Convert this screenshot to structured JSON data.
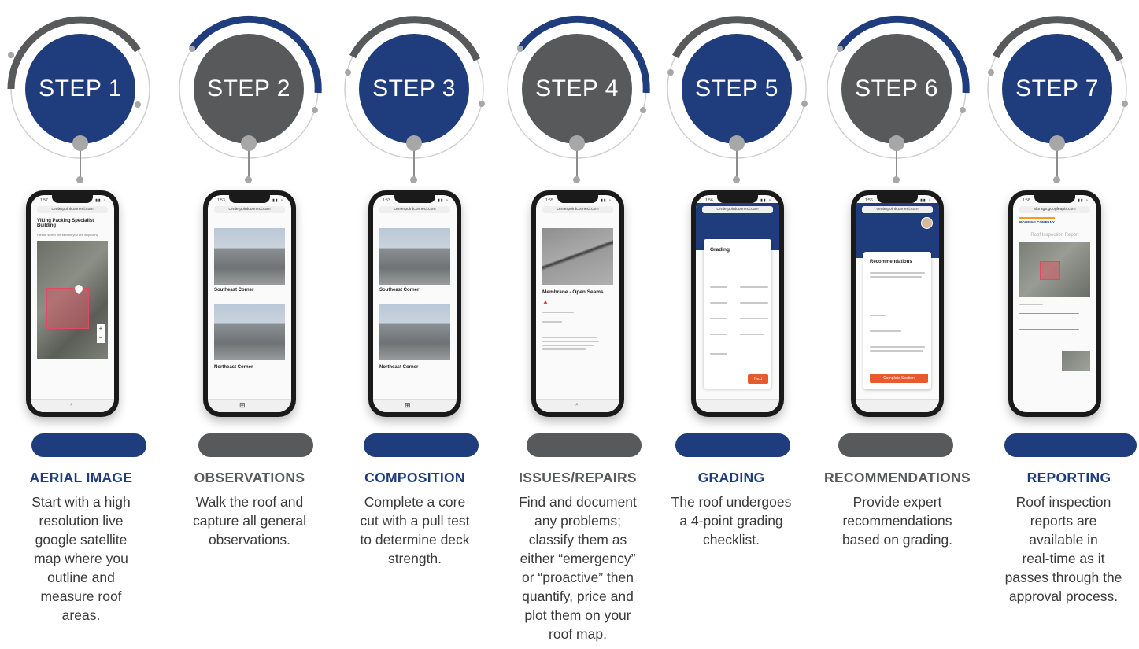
{
  "colors": {
    "navy": "#1f3c7c",
    "charcoal": "#58595b",
    "arc_gray": "#5c5c5c",
    "ring_gray": "#d0d0d0"
  },
  "steps": [
    {
      "badge": "STEP 1",
      "badge_color": "navy",
      "arc_color": "charcoal",
      "title": "AERIAL IMAGE",
      "title_color": "navy",
      "desc": [
        "Start with a high",
        "resolution live",
        "google satellite",
        "map where you",
        "outline and",
        "measure roof",
        "areas."
      ],
      "screen": {
        "url": "centerpointconnect.com",
        "heading": "Viking Packing Specialist Building",
        "subtext": "Please select the section you are inspecting"
      }
    },
    {
      "badge": "STEP 2",
      "badge_color": "charcoal",
      "arc_color": "navy",
      "title": "OBSERVATIONS",
      "title_color": "charcoal",
      "desc": [
        "Walk the roof and",
        "capture all general",
        "observations."
      ],
      "screen": {
        "url": "centerpointconnect.com",
        "caption_1": "Southeast Corner",
        "caption_2": "Northeast Corner"
      }
    },
    {
      "badge": "STEP 3",
      "badge_color": "navy",
      "arc_color": "charcoal",
      "title": "COMPOSITION",
      "title_color": "navy",
      "desc": [
        "Complete a core",
        "cut with a pull test",
        "to determine deck",
        "strength."
      ],
      "screen": {
        "url": "centerpointconnect.com",
        "caption_1": "Southeast Corner",
        "caption_2": "Northeast Corner"
      }
    },
    {
      "badge": "STEP 4",
      "badge_color": "charcoal",
      "arc_color": "navy",
      "title": "ISSUES/REPAIRS",
      "title_color": "charcoal",
      "desc": [
        "Find and document",
        "any problems;",
        "classify them as",
        "either “emergency”",
        "or “proactive” then",
        "quantify, price and",
        "plot them on your",
        "roof map."
      ],
      "screen": {
        "url": "centerpointconnect.com",
        "heading": "Membrane - Open Seams"
      }
    },
    {
      "badge": "STEP 5",
      "badge_color": "navy",
      "arc_color": "charcoal",
      "title": "GRADING",
      "title_color": "navy",
      "desc": [
        "The roof undergoes",
        "a 4-point grading",
        "checklist."
      ],
      "screen": {
        "url": "centerpointconnect.com",
        "heading": "Grading",
        "button": "Next"
      }
    },
    {
      "badge": "STEP 6",
      "badge_color": "charcoal",
      "arc_color": "navy",
      "title": "RECOMMENDATIONS",
      "title_color": "charcoal",
      "desc": [
        "Provide expert",
        "recommendations",
        "based on grading."
      ],
      "screen": {
        "url": "centerpointconnect.com",
        "heading": "Recommendations",
        "button": "Complete Section"
      }
    },
    {
      "badge": "STEP 7",
      "badge_color": "navy",
      "arc_color": "charcoal",
      "title": "REPORTING",
      "title_color": "navy",
      "desc": [
        "Roof inspection",
        "reports are",
        "available in",
        "real-time as it",
        "passes through the",
        "approval process."
      ],
      "screen": {
        "url": "storage.googleapis.com",
        "logo": "ROOFING COMPANY",
        "heading": "Roof Inspection Report"
      }
    }
  ]
}
